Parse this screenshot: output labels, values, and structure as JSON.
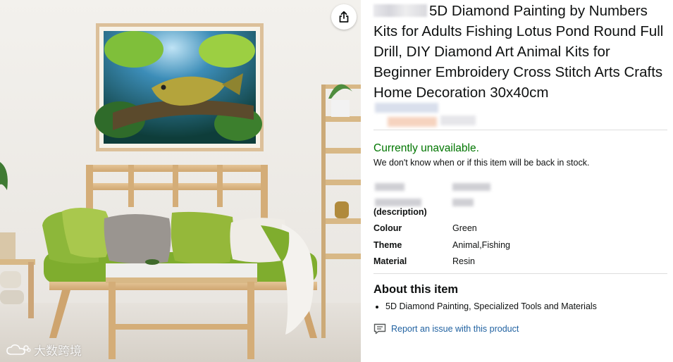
{
  "product": {
    "title": "5D Diamond Painting by Numbers Kits for Adults Fishing Lotus Pond Round Full Drill, DIY Diamond Art Animal Kits for Beginner Embroidery Cross Stitch Arts Crafts Home Decoration 30x40cm"
  },
  "availability": {
    "status": "Currently unavailable.",
    "note": "We don't know when or if this item will be back in stock."
  },
  "specs": {
    "description_label": "(description)",
    "rows": [
      {
        "label": "Colour",
        "value": "Green"
      },
      {
        "label": "Theme",
        "value": "Animal,Fishing"
      },
      {
        "label": "Material",
        "value": "Resin"
      }
    ]
  },
  "about": {
    "title": "About this item",
    "bullets": [
      "5D Diamond Painting, Specialized Tools and Materials"
    ]
  },
  "report": {
    "label": "Report an issue with this product"
  },
  "watermark": {
    "text": "大数跨境"
  },
  "icons": {
    "share": "share-icon",
    "report": "comment-flag-icon",
    "watermark": "cloud-logo-icon"
  },
  "colors": {
    "available_green": "#007600",
    "link_blue": "#2162a1",
    "text": "#0f1111"
  }
}
